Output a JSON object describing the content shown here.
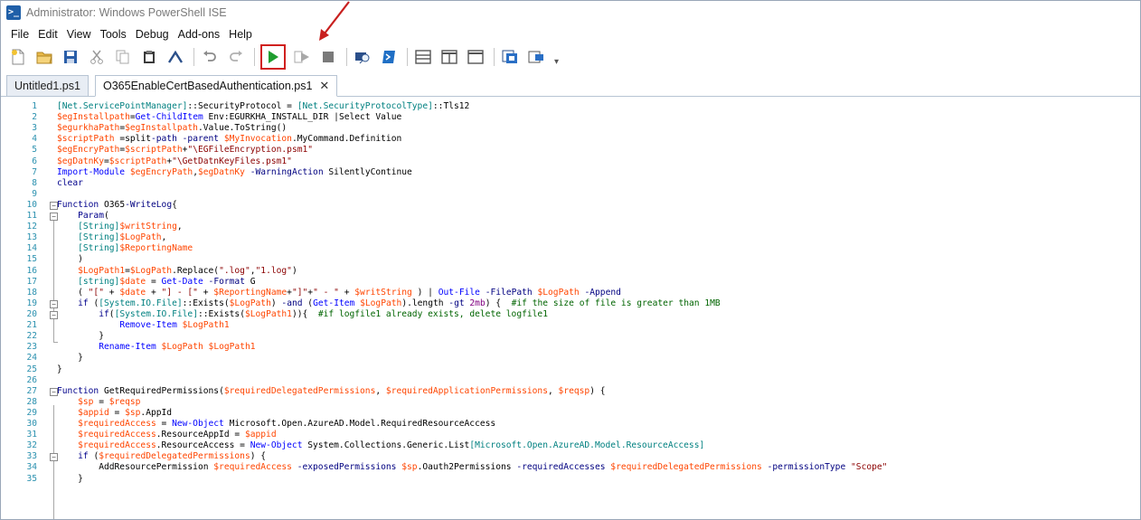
{
  "window": {
    "title": "Administrator: Windows PowerShell ISE",
    "app_icon_glyph": ">_"
  },
  "menu": [
    "File",
    "Edit",
    "View",
    "Tools",
    "Debug",
    "Add-ons",
    "Help"
  ],
  "toolbar": {
    "icons": [
      "new-file-icon",
      "open-folder-icon",
      "save-icon",
      "cut-icon",
      "copy-icon",
      "paste-icon",
      "clear-console-icon",
      "undo-icon",
      "redo-icon",
      "run-script-icon",
      "run-selection-icon",
      "stop-icon",
      "new-remote-tab-icon",
      "start-powershell-icon",
      "show-script-pane-top-icon",
      "show-script-pane-right-icon",
      "show-script-pane-max-icon",
      "show-command-window-icon",
      "show-command-addon-icon"
    ],
    "overflow_glyph": "▾",
    "run_highlight_color": "#d0201e"
  },
  "tabs": [
    {
      "label": "Untitled1.ps1",
      "active": false
    },
    {
      "label": "O365EnableCertBasedAuthentication.ps1",
      "active": true,
      "close_glyph": "✕"
    }
  ],
  "editor": {
    "lines": [
      {
        "n": "1",
        "text": "[Net.ServicePointManager]::SecurityProtocol = [Net.SecurityProtocolType]::Tls12"
      },
      {
        "n": "2",
        "text": "$egInstallpath=Get-ChildItem Env:EGURKHA_INSTALL_DIR |Select Value"
      },
      {
        "n": "3",
        "text": "$egurkhaPath=$egInstallpath.Value.ToString()"
      },
      {
        "n": "4",
        "text": "$scriptPath =split-path -parent $MyInvocation.MyCommand.Definition"
      },
      {
        "n": "5",
        "text": "$egEncryPath=$scriptPath+\"\\EGFileEncryption.psm1\""
      },
      {
        "n": "6",
        "text": "$egDatnKy=$scriptPath+\"\\GetDatnKeyFiles.psm1\""
      },
      {
        "n": "7",
        "text": "Import-Module $egEncryPath,$egDatnKy -WarningAction SilentlyContinue"
      },
      {
        "n": "8",
        "text": "clear"
      },
      {
        "n": "9",
        "text": ""
      },
      {
        "n": "10",
        "text": "Function O365-WriteLog{"
      },
      {
        "n": "11",
        "text": "    Param("
      },
      {
        "n": "12",
        "text": "    [String]$writString,"
      },
      {
        "n": "13",
        "text": "    [String]$LogPath,"
      },
      {
        "n": "14",
        "text": "    [String]$ReportingName"
      },
      {
        "n": "15",
        "text": "    )"
      },
      {
        "n": "16",
        "text": "    $LogPath1=$LogPath.Replace(\".log\",\"1.log\")"
      },
      {
        "n": "17",
        "text": "    [string]$date = Get-Date -Format G"
      },
      {
        "n": "18",
        "text": "    ( \"[\" + $date + \"] - [\" + $ReportingName+\"]\"+\" - \" + $writString ) | Out-File -FilePath $LogPath -Append"
      },
      {
        "n": "19",
        "text": "    if ([System.IO.File]::Exists($LogPath) -and (Get-Item $LogPath).length -gt 2mb) {  #if the size of file is greater than 1MB"
      },
      {
        "n": "20",
        "text": "        if([System.IO.File]::Exists($LogPath1)){  #if logfile1 already exists, delete logfile1"
      },
      {
        "n": "21",
        "text": "            Remove-Item $LogPath1"
      },
      {
        "n": "22",
        "text": "        }"
      },
      {
        "n": "23",
        "text": "        Rename-Item $LogPath $LogPath1"
      },
      {
        "n": "24",
        "text": "    }"
      },
      {
        "n": "25",
        "text": "}"
      },
      {
        "n": "26",
        "text": ""
      },
      {
        "n": "27",
        "text": "Function GetRequiredPermissions($requiredDelegatedPermissions, $requiredApplicationPermissions, $reqsp) {"
      },
      {
        "n": "28",
        "text": "    $sp = $reqsp"
      },
      {
        "n": "29",
        "text": "    $appid = $sp.AppId"
      },
      {
        "n": "30",
        "text": "    $requiredAccess = New-Object Microsoft.Open.AzureAD.Model.RequiredResourceAccess"
      },
      {
        "n": "31",
        "text": "    $requiredAccess.ResourceAppId = $appid"
      },
      {
        "n": "32",
        "text": "    $requiredAccess.ResourceAccess = New-Object System.Collections.Generic.List[Microsoft.Open.AzureAD.Model.ResourceAccess]"
      },
      {
        "n": "33",
        "text": "    if ($requiredDelegatedPermissions) {"
      },
      {
        "n": "34",
        "text": "        AddResourcePermission $requiredAccess -exposedPermissions $sp.Oauth2Permissions -requiredAccesses $requiredDelegatedPermissions -permissionType \"Scope\""
      },
      {
        "n": "35",
        "text": "    }"
      }
    ]
  }
}
